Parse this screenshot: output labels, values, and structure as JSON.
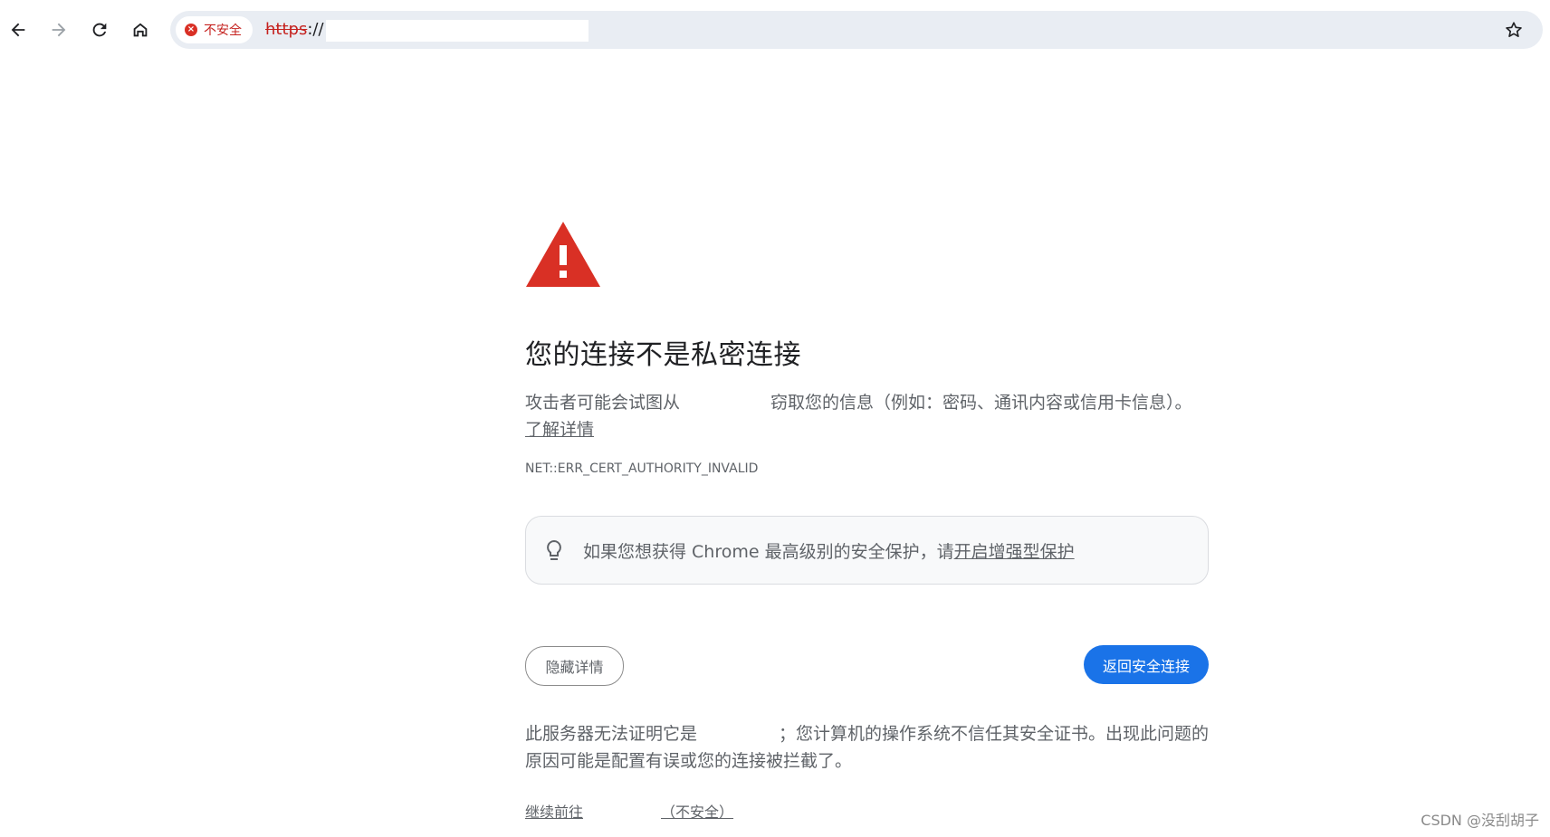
{
  "toolbar": {
    "security_chip_label": "不安全",
    "url_scheme": "https",
    "url_separator": "://"
  },
  "interstitial": {
    "title": "您的连接不是私密连接",
    "para1_before": "攻击者可能会试图从",
    "para1_after": "窃取您的信息（例如：密码、通讯内容或信用卡信息）。",
    "learn_more": "了解详情",
    "error_code": "NET::ERR_CERT_AUTHORITY_INVALID",
    "tip_text": "如果您想获得 Chrome 最高级别的安全保护，请",
    "tip_link": "开启增强型保护",
    "hide_details": "隐藏详情",
    "back_to_safety": "返回安全连接",
    "para2_before": "此服务器无法证明它是",
    "para2_after": "；您计算机的操作系统不信任其安全证书。出现此问题的原因可能是配置有误或您的连接被拦截了。",
    "proceed_before": "继续前往",
    "proceed_after": "（不安全）"
  },
  "watermark": "CSDN @没刮胡子",
  "colors": {
    "warning_red": "#d93025",
    "primary_blue": "#1a73e8",
    "omnibox_bg": "#e9edf3"
  },
  "icons": [
    "back-arrow-icon",
    "forward-arrow-icon",
    "reload-icon",
    "home-icon",
    "error-circle-icon",
    "star-icon",
    "warning-triangle-icon",
    "lightbulb-icon"
  ]
}
